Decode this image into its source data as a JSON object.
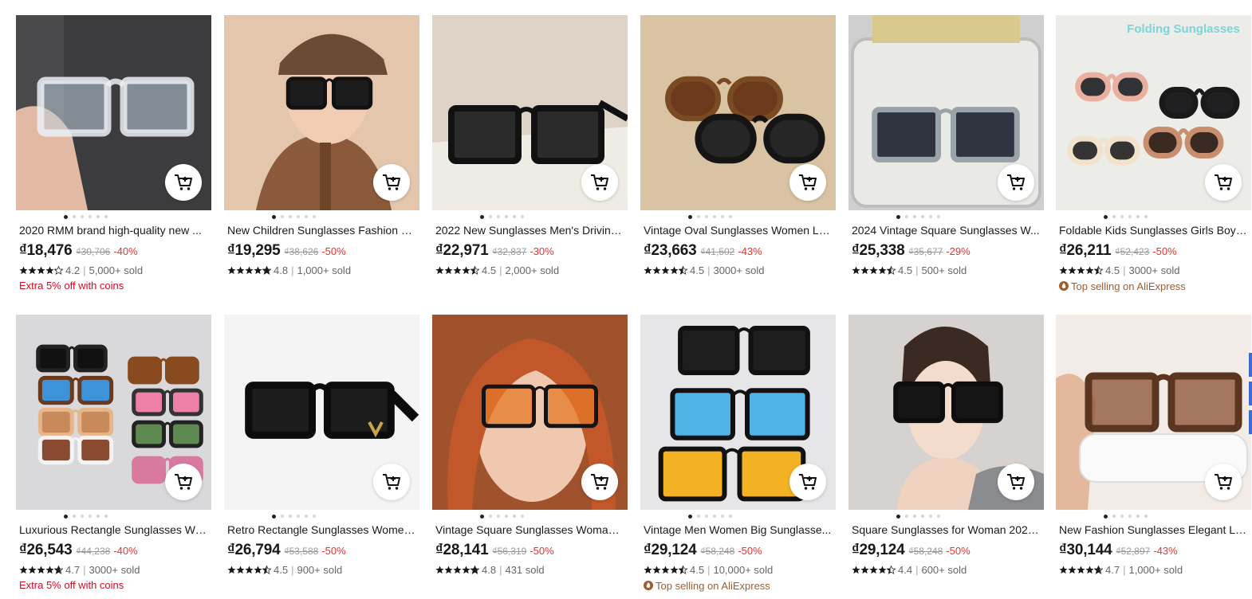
{
  "currency_symbol": "₫",
  "products": [
    {
      "title": "2020 RMM brand high-quality new ...",
      "price": "₫18,476",
      "original": "₫30,706",
      "discount": "-40%",
      "rating": "4.2",
      "sold": "5,000+ sold",
      "promo": "Extra 5% off with coins",
      "promo_type": "coins",
      "image": "clear-frame-sunglasses-in-hand"
    },
    {
      "title": "New Children Sunglasses Fashion C...",
      "price": "₫19,295",
      "original": "₫38,626",
      "discount": "-50%",
      "rating": "4.8",
      "sold": "1,000+ sold",
      "promo": "",
      "promo_type": "",
      "image": "child-wearing-sunglasses"
    },
    {
      "title": "2022 New Sunglasses Men's Driving...",
      "price": "₫22,971",
      "original": "₫32,837",
      "discount": "-30%",
      "rating": "4.5",
      "sold": "2,000+ sold",
      "promo": "",
      "promo_type": "",
      "image": "black-square-sunglasses"
    },
    {
      "title": "Vintage Oval Sunglasses Women Lu...",
      "price": "₫23,663",
      "original": "₫41,502",
      "discount": "-43%",
      "rating": "4.5",
      "sold": "3000+ sold",
      "promo": "",
      "promo_type": "",
      "image": "oval-sunglasses-pair"
    },
    {
      "title": "2024 Vintage Square Sunglasses W...",
      "price": "₫25,338",
      "original": "₫35,677",
      "discount": "-29%",
      "rating": "4.5",
      "sold": "500+ sold",
      "promo": "",
      "promo_type": "",
      "image": "sunglasses-in-case"
    },
    {
      "title": "Foldable Kids Sunglasses Girls Boy ...",
      "price": "₫26,211",
      "original": "₫52,423",
      "discount": "-50%",
      "rating": "4.5",
      "sold": "3000+ sold",
      "promo": "Top selling on AliExpress",
      "promo_type": "top",
      "image": "folding-kids-sunglasses",
      "overlay": "Folding Sunglasses"
    },
    {
      "title": "Luxurious Rectangle Sunglasses Wo...",
      "price": "₫26,543",
      "original": "₫44,238",
      "discount": "-40%",
      "rating": "4.7",
      "sold": "3000+ sold",
      "promo": "Extra 5% off with coins",
      "promo_type": "coins",
      "image": "colorful-rectangle-sunglasses"
    },
    {
      "title": "Retro Rectangle Sunglasses Women...",
      "price": "₫26,794",
      "original": "₫53,588",
      "discount": "-50%",
      "rating": "4.5",
      "sold": "900+ sold",
      "promo": "",
      "promo_type": "",
      "image": "black-rectangle-sunglasses-v"
    },
    {
      "title": "Vintage Square Sunglasses Woman ...",
      "price": "₫28,141",
      "original": "₫56,319",
      "discount": "-50%",
      "rating": "4.8",
      "sold": "431 sold",
      "promo": "",
      "promo_type": "",
      "image": "woman-orange-lens-sunglasses"
    },
    {
      "title": "Vintage Men Women Big Sunglasse...",
      "price": "₫29,124",
      "original": "₫58,248",
      "discount": "-50%",
      "rating": "4.5",
      "sold": "10,000+ sold",
      "promo": "Top selling on AliExpress",
      "promo_type": "top",
      "image": "aviator-sunglasses-stack"
    },
    {
      "title": "Square Sunglasses for Woman 2023...",
      "price": "₫29,124",
      "original": "₫58,248",
      "discount": "-50%",
      "rating": "4.4",
      "sold": "600+ sold",
      "promo": "",
      "promo_type": "",
      "image": "woman-black-sunglasses"
    },
    {
      "title": "New Fashion Sunglasses Elegant La...",
      "price": "₫30,144",
      "original": "₫52,897",
      "discount": "-43%",
      "rating": "4.7",
      "sold": "1,000+ sold",
      "promo": "",
      "promo_type": "",
      "image": "tortoise-cat-eye-sunglasses"
    }
  ],
  "colors": {
    "discount": "#e6312e",
    "coins_promo": "#d10c26",
    "top_promo": "#a15d2e",
    "star": "#191919"
  }
}
